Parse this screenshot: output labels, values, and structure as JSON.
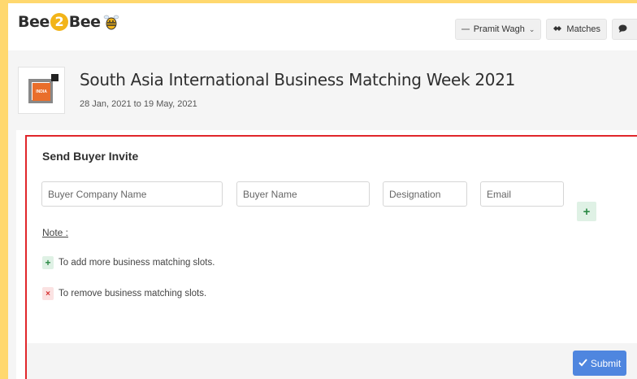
{
  "brand": {
    "logo_text_a": "Bee",
    "logo_text_b": "2",
    "logo_text_c": "Bee"
  },
  "nav": {
    "user_name": "Pramit Wagh",
    "matches_label": "Matches",
    "icons": {
      "user": "avatar-placeholder",
      "matches": "handshake-icon",
      "chat": "chat-bubble-icon"
    }
  },
  "event": {
    "title": "South Asia International Business Matching Week 2021",
    "dates": "28 Jan, 2021 to 19 May, 2021",
    "logo_badge": "INDIA"
  },
  "form": {
    "title": "Send Buyer Invite",
    "fields": {
      "company_placeholder": "Buyer Company Name",
      "buyer_placeholder": "Buyer Name",
      "designation_placeholder": "Designation",
      "email_placeholder": "Email"
    },
    "add_symbol": "+",
    "note_label": "Note :",
    "legend_add_symbol": "+",
    "legend_add_text": "To add more business matching slots.",
    "legend_remove_symbol": "×",
    "legend_remove_text": "To remove business matching slots.",
    "submit_label": "Submit"
  },
  "colors": {
    "brand_yellow": "#ffd86e",
    "highlight_red": "#e0262b",
    "submit_blue": "#4f86df",
    "add_green": "#2b8a45",
    "remove_red": "#d63131"
  }
}
